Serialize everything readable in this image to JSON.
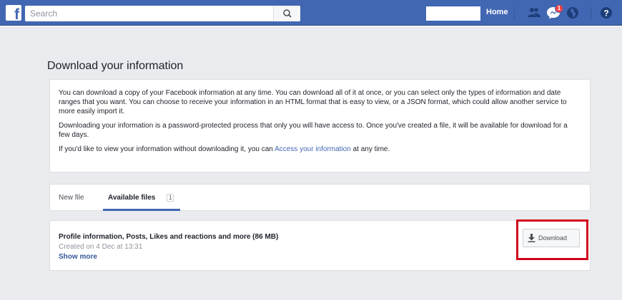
{
  "topbar": {
    "search_placeholder": "Search",
    "home_label": "Home",
    "notification_count": "1",
    "colors": {
      "bar": "#4267b2",
      "badge": "#fa3e3e"
    }
  },
  "page": {
    "title": "Download your information"
  },
  "info": {
    "paragraph1": "You can download a copy of your Facebook information at any time. You can download all of it at once, or you can select only the types of information and date ranges that you want. You can choose to receive your information in an HTML format that is easy to view, or a JSON format, which could allow another service to more easily import it.",
    "paragraph2": "Downloading your information is a password-protected process that only you will have access to. Once you've created a file, it will be available for download for a few days.",
    "paragraph3_before": "If you'd like to view your information without downloading it, you can ",
    "paragraph3_link": "Access your information",
    "paragraph3_after": " at any time."
  },
  "tabs": {
    "new_file": "New file",
    "available_files": "Available files",
    "available_count": "1"
  },
  "file": {
    "title": "Profile information, Posts, Likes and reactions and more (86 MB)",
    "created": "Created on 4 Dec at 13:31",
    "show_more": "Show more",
    "download_label": "Download"
  },
  "icons": [
    "facebook-logo-icon",
    "search-icon",
    "friends-icon",
    "messenger-icon",
    "globe-icon",
    "help-icon",
    "download-icon"
  ]
}
